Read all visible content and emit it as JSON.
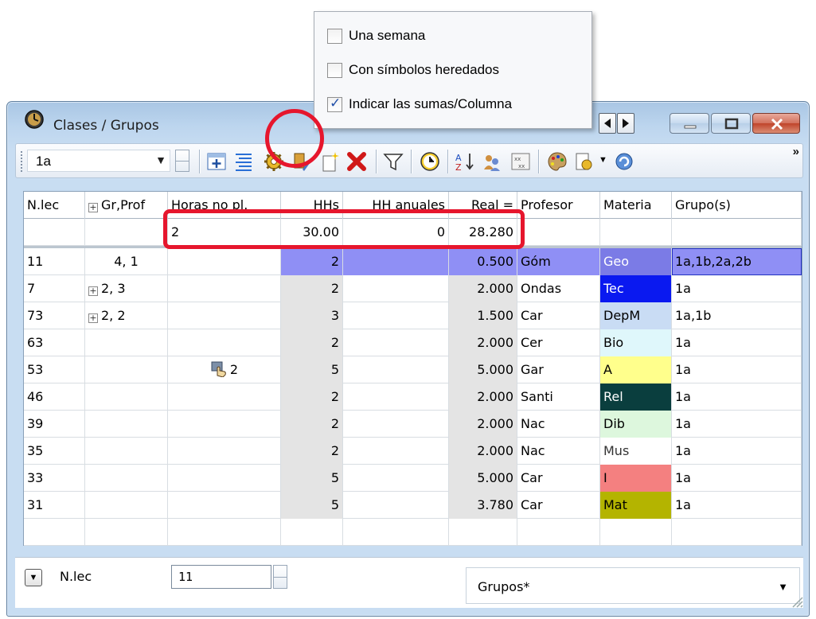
{
  "window": {
    "title": "Clases / Grupos"
  },
  "toolbar": {
    "class_selector_value": "1a",
    "more_label": "»"
  },
  "popup_menu": {
    "items": [
      {
        "label": "Una semana",
        "checked": false
      },
      {
        "label": "Con símbolos heredados",
        "checked": false
      },
      {
        "label": "Indicar las sumas/Columna",
        "checked": true
      }
    ]
  },
  "grid": {
    "columns": [
      "N.lec",
      "Gr,Prof",
      "Horas no pl.",
      "HHs",
      "HH anuales",
      "Real =",
      "Profesor",
      "Materia",
      "Grupo(s)"
    ],
    "sums": {
      "horas_no_pl": "2",
      "hhs": "30.00",
      "hh_anuales": "0",
      "real": "28.280"
    },
    "rows": [
      {
        "nlec": "11",
        "grprof": "4, 1",
        "grprof_expand": false,
        "horas": "",
        "hhs": "2",
        "real": "0.500",
        "profesor": "Góm",
        "materia": "Geo",
        "materia_bg": "#7b7be6",
        "materia_fg": "#ffffff",
        "grupos": "1a,1b,2a,2b"
      },
      {
        "nlec": "7",
        "grprof": "2, 3",
        "grprof_expand": true,
        "horas": "",
        "hhs": "2",
        "real": "2.000",
        "profesor": "Ondas",
        "materia": "Tec",
        "materia_bg": "#0a19f0",
        "materia_fg": "#ffffff",
        "grupos": "1a"
      },
      {
        "nlec": "73",
        "grprof": "2, 2",
        "grprof_expand": true,
        "horas": "",
        "hhs": "3",
        "real": "1.500",
        "profesor": "Car",
        "materia": "DepM",
        "materia_bg": "#c9dcf4",
        "materia_fg": "#000000",
        "grupos": "1a,1b"
      },
      {
        "nlec": "63",
        "grprof": "",
        "grprof_expand": false,
        "horas": "",
        "hhs": "2",
        "real": "2.000",
        "profesor": "Cer",
        "materia": "Bio",
        "materia_bg": "#dff7fb",
        "materia_fg": "#000000",
        "grupos": "1a"
      },
      {
        "nlec": "53",
        "grprof": "",
        "grprof_expand": false,
        "horas": "2",
        "hhs": "5",
        "real": "5.000",
        "profesor": "Gar",
        "materia": "A",
        "materia_bg": "#ffff8c",
        "materia_fg": "#000000",
        "grupos": "1a"
      },
      {
        "nlec": "46",
        "grprof": "",
        "grprof_expand": false,
        "horas": "",
        "hhs": "2",
        "real": "2.000",
        "profesor": "Santi",
        "materia": "Rel",
        "materia_bg": "#0a3e3e",
        "materia_fg": "#ffffff",
        "grupos": "1a"
      },
      {
        "nlec": "39",
        "grprof": "",
        "grprof_expand": false,
        "horas": "",
        "hhs": "2",
        "real": "2.000",
        "profesor": "Nac",
        "materia": "Dib",
        "materia_bg": "#ddf7dd",
        "materia_fg": "#000000",
        "grupos": "1a"
      },
      {
        "nlec": "35",
        "grprof": "",
        "grprof_expand": false,
        "horas": "",
        "hhs": "2",
        "real": "2.000",
        "profesor": "Nac",
        "materia": "Mus",
        "materia_bg": "#ffffff",
        "materia_fg": "#333333",
        "grupos": "1a"
      },
      {
        "nlec": "33",
        "grprof": "",
        "grprof_expand": false,
        "horas": "",
        "hhs": "5",
        "real": "5.000",
        "profesor": "Car",
        "materia": "I",
        "materia_bg": "#f48080",
        "materia_fg": "#000000",
        "grupos": "1a"
      },
      {
        "nlec": "31",
        "grprof": "",
        "grprof_expand": false,
        "horas": "",
        "hhs": "5",
        "real": "3.780",
        "profesor": "Car",
        "materia": "Mat",
        "materia_bg": "#b4b400",
        "materia_fg": "#000000",
        "grupos": "1a"
      }
    ],
    "selected_row": 0
  },
  "bottom_bar": {
    "field_label": "N.lec",
    "field_value": "11",
    "view_combo_value": "Grupos*"
  },
  "colors": {
    "selection": "#8f8ff5",
    "annotation": "#e6162d"
  }
}
